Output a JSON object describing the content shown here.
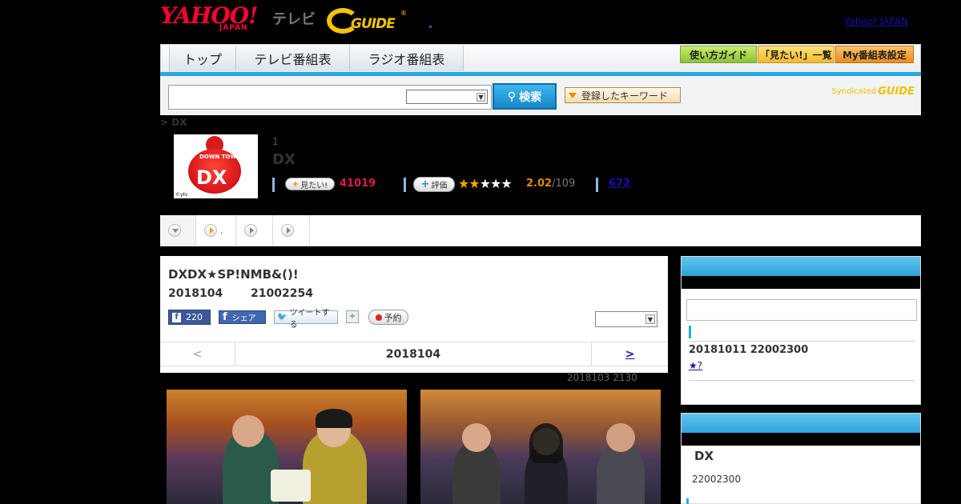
{
  "header": {
    "yahoo_logo": "YAHOO!",
    "yahoo_japan": "JAPAN",
    "tv_label": "テレビ",
    "gguide_logo": "GUIDE",
    "yahoo_japan_link": "Yahoo! JAPAN"
  },
  "nav": {
    "tabs": [
      "トップ",
      "テレビ番組表",
      "ラジオ番組表"
    ],
    "buttons": [
      "使い方ガイド",
      "「見たい!」一覧",
      "My番組表設定"
    ]
  },
  "search": {
    "input_value": "",
    "select_value": "",
    "search_button": "検索",
    "keyword_button": "登録したキーワード",
    "syndicated": "Syndicated",
    "syndicated_logo": "GUIDE"
  },
  "breadcrumb": "> DX",
  "program": {
    "episode_count": "1",
    "title": "DX",
    "thumb_text": "DOWN TOWN",
    "thumb_dx": "DX",
    "thumb_credit": "©ytv",
    "mitai_label": "見たい!",
    "mitai_count": "41019",
    "hyouka_label": "評価",
    "rating": 2.02,
    "rating_score": "2.02",
    "rating_count": "/109",
    "review_count": "672"
  },
  "subtabs": [
    ".",
    "",
    ""
  ],
  "episode": {
    "title": "DXDX★SP!NMB&()!",
    "date": "2018104",
    "time": "21002254",
    "fb_count": "220",
    "fb_share": "シェア",
    "tweet": "ツイートする",
    "reserve": "予約",
    "pager_prev": "<",
    "pager_date": "2018104",
    "pager_next": ">",
    "updated": "2018103  2130"
  },
  "sidebar": {
    "next_datetime": "20181011  22002300",
    "next_link": "★?",
    "related_title": "DX",
    "related_time": "22002300"
  },
  "colors": {
    "accent_blue": "#29a9e0",
    "mitai_red": "#e0174b",
    "rating_orange": "#e08a00",
    "link": "#1a0dab"
  }
}
